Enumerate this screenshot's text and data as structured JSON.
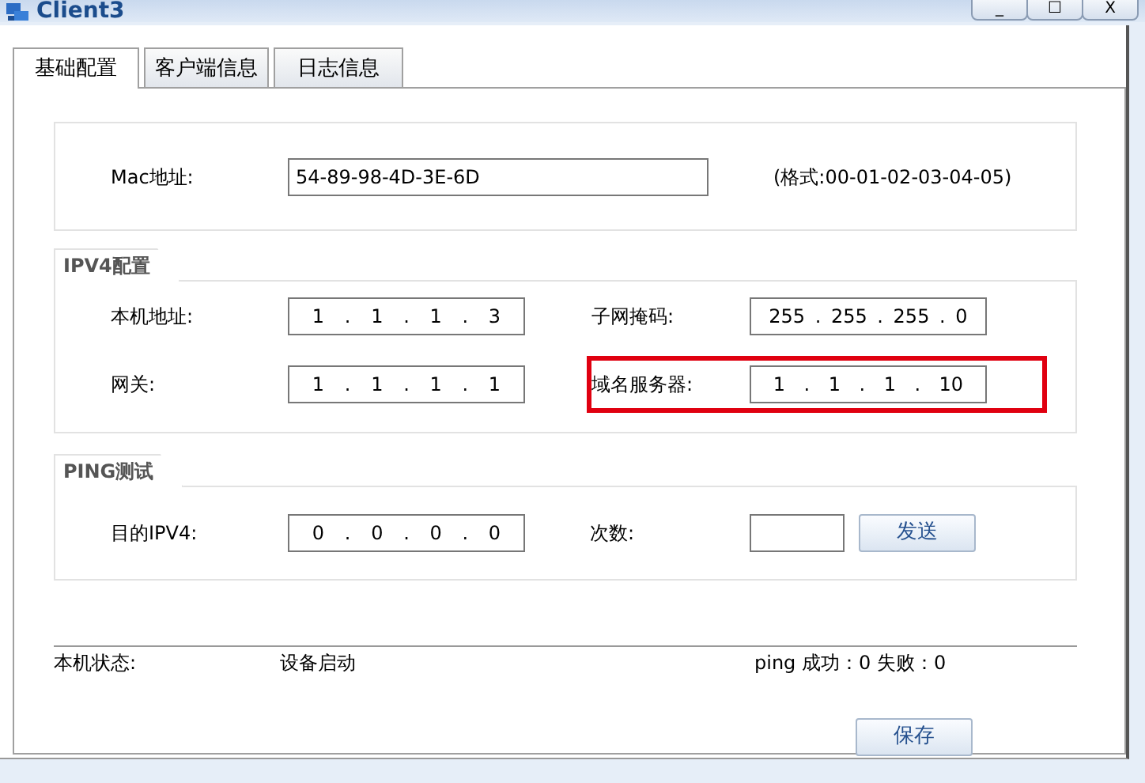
{
  "window": {
    "title": "Client3",
    "controls": [
      "_",
      "☐",
      "X"
    ]
  },
  "tabs": [
    {
      "label": "基础配置",
      "selected": true
    },
    {
      "label": "客户端信息",
      "selected": false
    },
    {
      "label": "日志信息",
      "selected": false
    }
  ],
  "mac": {
    "label": "Mac地址:",
    "value": "54-89-98-4D-3E-6D",
    "hint": "(格式:00-01-02-03-04-05)"
  },
  "ipv4": {
    "title": "IPV4配置",
    "fields": [
      {
        "label": "本机地址:",
        "parts": [
          "1",
          ".",
          "1",
          ".",
          "1",
          ".",
          "3"
        ],
        "highlighted": false
      },
      {
        "label": "子网掩码:",
        "parts": [
          "255",
          ".",
          "255",
          ".",
          "255",
          ".",
          "0"
        ],
        "highlighted": false
      },
      {
        "label": "网关:",
        "parts": [
          "1",
          ".",
          "1",
          ".",
          "1",
          ".",
          "1"
        ],
        "highlighted": false
      },
      {
        "label": "域名服务器:",
        "parts": [
          "1",
          ".",
          "1",
          ".",
          "1",
          ".",
          "10"
        ],
        "highlighted": true
      }
    ]
  },
  "ping": {
    "title": "PING测试",
    "target_label": "目的IPV4:",
    "target_parts": [
      "0",
      ".",
      "0",
      ".",
      "0",
      ".",
      "0"
    ],
    "count_label": "次数:",
    "send_button": "发送"
  },
  "status": {
    "label": "本机状态:",
    "value": "设备启动",
    "ping_result": "ping 成功：0 失败：0"
  },
  "save_button": "保存"
}
